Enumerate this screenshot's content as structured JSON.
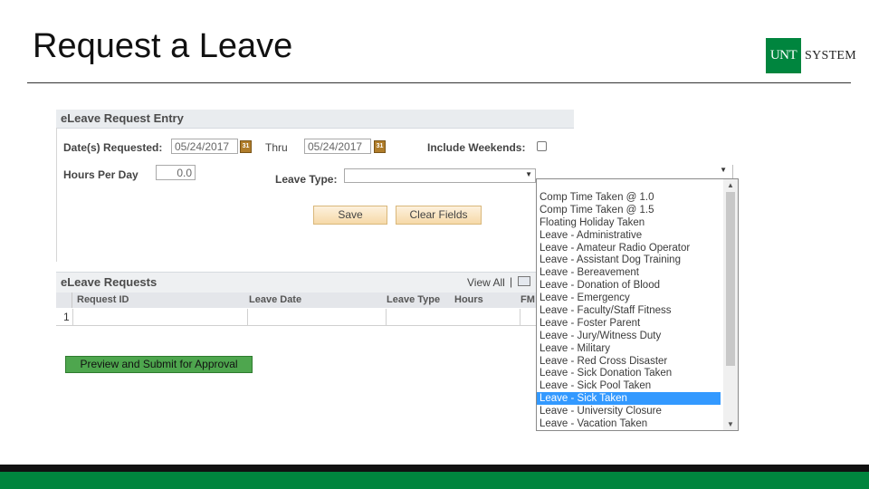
{
  "slide": {
    "title": "Request a Leave"
  },
  "logo": {
    "box": "UNT",
    "text": "SYSTEM"
  },
  "entry": {
    "header": "eLeave Request Entry",
    "dates_label": "Date(s) Requested:",
    "date_from": "05/24/2017",
    "thru_label": "Thru",
    "date_thru": "05/24/2017",
    "weekends_label": "Include Weekends:",
    "hours_label": "Hours Per Day",
    "hours_value": "0.0",
    "leave_type_label": "Leave Type:",
    "save_label": "Save",
    "clear_label": "Clear Fields"
  },
  "requests": {
    "header": "eLeave Requests",
    "view_all": "View All",
    "sep": "|",
    "columns": [
      "Request ID",
      "Leave Date",
      "Leave Type",
      "Hours",
      "FM"
    ],
    "row_number": "1"
  },
  "submit_label": "Preview and Submit for Approval",
  "dropdown": {
    "options": [
      "Comp Time Taken @ 1.0",
      "Comp Time Taken @ 1.5",
      "Floating Holiday Taken",
      "Leave - Administrative",
      "Leave - Amateur Radio Operator",
      "Leave - Assistant Dog Training",
      "Leave - Bereavement",
      "Leave - Donation of Blood",
      "Leave - Emergency",
      "Leave - Faculty/Staff Fitness",
      "Leave - Foster Parent",
      "Leave - Jury/Witness Duty",
      "Leave - Military",
      "Leave - Red Cross Disaster",
      "Leave - Sick Donation Taken",
      "Leave - Sick Pool Taken",
      "Leave - Sick Taken",
      "Leave - University Closure",
      "Leave - Vacation Taken"
    ],
    "selected": "Leave - Sick Taken"
  },
  "colors": {
    "brand_green": "#00853e",
    "selection": "#3399ff",
    "submit_green": "#4ea64e"
  },
  "icons": {
    "calendar": "calendar-icon",
    "view_all": "view-all-icon"
  }
}
